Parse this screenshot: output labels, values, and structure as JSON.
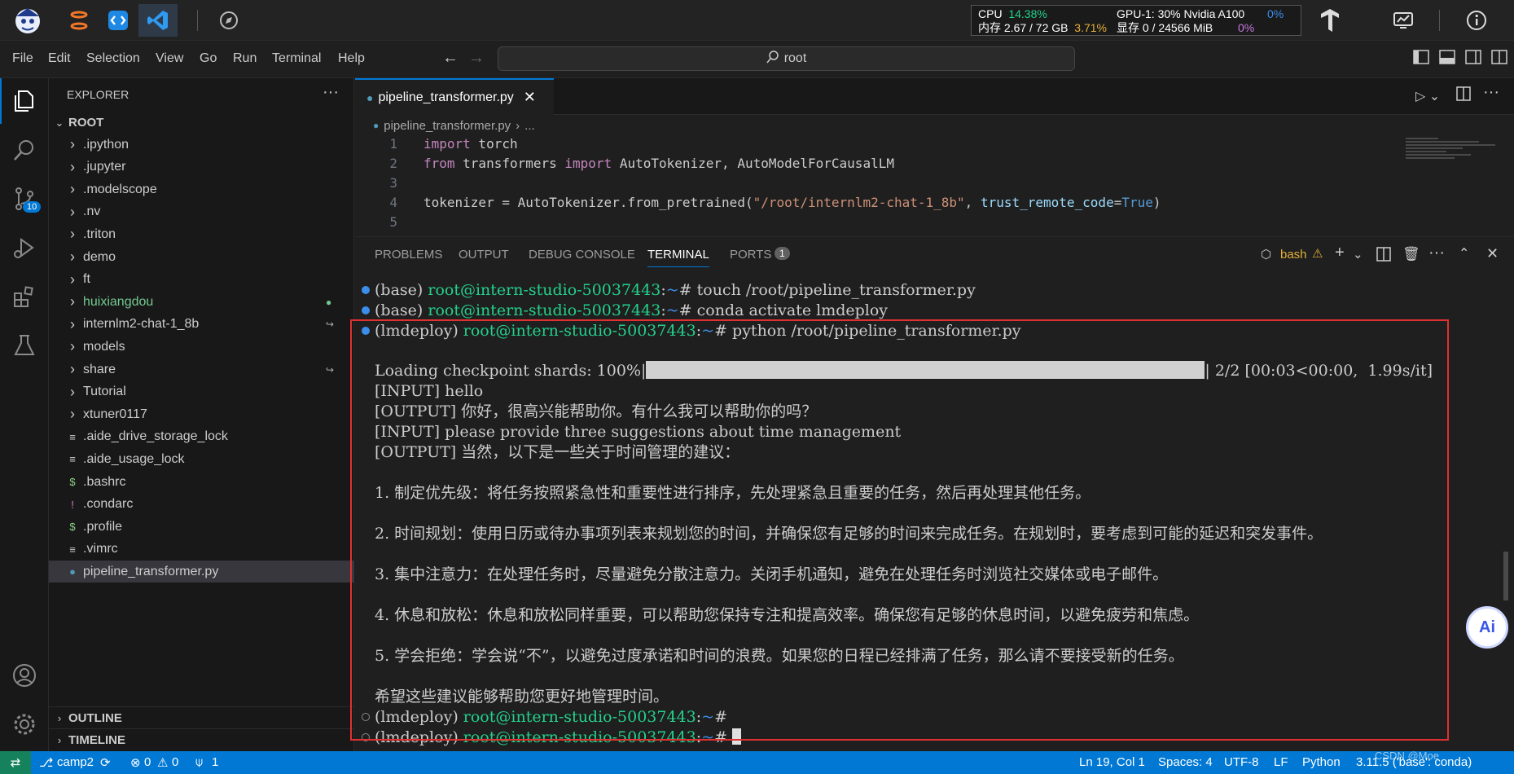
{
  "topbar": {
    "stats": {
      "cpu_label": "CPU",
      "cpu_value": "14.38%",
      "mem_label": "内存 2.67 / 72 GB",
      "mem_value": "3.71%",
      "gpu_label": "GPU-1: 30% Nvidia A100",
      "gpu_value": "0%",
      "vram_label": "显存 0 / 24566 MiB",
      "vram_value": "0%"
    }
  },
  "menu": [
    "File",
    "Edit",
    "Selection",
    "View",
    "Go",
    "Run",
    "Terminal",
    "Help"
  ],
  "command_center": {
    "text": "root"
  },
  "activity": {
    "badge": "10"
  },
  "explorer": {
    "title": "EXPLORER",
    "root": "ROOT",
    "items": [
      {
        "label": ".ipython",
        "type": "folder"
      },
      {
        "label": ".jupyter",
        "type": "folder"
      },
      {
        "label": ".modelscope",
        "type": "folder"
      },
      {
        "label": ".nv",
        "type": "folder"
      },
      {
        "label": ".triton",
        "type": "folder"
      },
      {
        "label": "demo",
        "type": "folder"
      },
      {
        "label": "ft",
        "type": "folder"
      },
      {
        "label": "huixiangdou",
        "type": "folder"
      },
      {
        "label": "internlm2-chat-1_8b",
        "type": "folder"
      },
      {
        "label": "models",
        "type": "folder"
      },
      {
        "label": "share",
        "type": "folder"
      },
      {
        "label": "Tutorial",
        "type": "folder"
      },
      {
        "label": "xtuner0117",
        "type": "folder"
      },
      {
        "label": ".aide_drive_storage_lock",
        "type": "file"
      },
      {
        "label": ".aide_usage_lock",
        "type": "file"
      },
      {
        "label": ".bashrc",
        "type": "file"
      },
      {
        "label": ".condarc",
        "type": "file"
      },
      {
        "label": ".profile",
        "type": "file"
      },
      {
        "label": ".vimrc",
        "type": "file"
      },
      {
        "label": "pipeline_transformer.py",
        "type": "file"
      }
    ],
    "outline": "OUTLINE",
    "timeline": "TIMELINE"
  },
  "editor": {
    "tab": "pipeline_transformer.py",
    "breadcrumb_file": "pipeline_transformer.py",
    "breadcrumb_more": "...",
    "line_numbers": [
      "1",
      "2",
      "3",
      "4",
      "5"
    ]
  },
  "panel": {
    "tabs": [
      "PROBLEMS",
      "OUTPUT",
      "DEBUG CONSOLE",
      "TERMINAL",
      "PORTS"
    ],
    "ports_badge": "1",
    "shell": "bash"
  },
  "terminal": {
    "prompt_user": "root@intern-studio-50037443",
    "prompt_path": "~",
    "lines": {
      "l1_env": "(base) ",
      "l1_cmd": "# touch /root/pipeline_transformer.py",
      "l2_env": "(base) ",
      "l2_cmd": "# conda activate lmdeploy",
      "l3_env": "(lmdeploy) ",
      "l3_cmd": "# python /root/pipeline_transformer.py",
      "loading": "Loading checkpoint shards: 100%|",
      "loading_tail": "| 2/2 [00:03<00:00,  1.99s/it]",
      "in1": "[INPUT] hello",
      "out1": "[OUTPUT] 你好，很高兴能帮助你。有什么我可以帮助你的吗？",
      "in2": "[INPUT] please provide three suggestions about time management",
      "out2": "[OUTPUT] 当然，以下是一些关于时间管理的建议：",
      "s1": "1. 制定优先级：将任务按照紧急性和重要性进行排序，先处理紧急且重要的任务，然后再处理其他任务。",
      "s2": "2. 时间规划：使用日历或待办事项列表来规划您的时间，并确保您有足够的时间来完成任务。在规划时，要考虑到可能的延迟和突发事件。",
      "s3": "3. 集中注意力：在处理任务时，尽量避免分散注意力。关闭手机通知，避免在处理任务时浏览社交媒体或电子邮件。",
      "s4": "4. 休息和放松：休息和放松同样重要，可以帮助您保持专注和提高效率。确保您有足够的休息时间，以避免疲劳和焦虑。",
      "s5": "5. 学会拒绝：学会说“不”，以避免过度承诺和时间的浪费。如果您的日程已经排满了任务，那么请不要接受新的任务。",
      "closing": "希望这些建议能够帮助您更好地管理时间。",
      "l4_env": "(lmdeploy) ",
      "l4_cmd": "#",
      "l5_env": "(lmdeploy) ",
      "l5_cmd": "# "
    },
    "progress": 1.0
  },
  "statusbar": {
    "branch": "camp2",
    "errors": "0",
    "warnings": "0",
    "ports": "1",
    "position": "Ln 19, Col 1",
    "spaces": "Spaces: 4",
    "encoding": "UTF-8",
    "eol": "LF",
    "language": "Python",
    "interpreter": "3.11.5 ('base': conda)",
    "watermark": "CSDN @Moe"
  },
  "ai_button": "Ai",
  "colors": {
    "accent": "#0078d4",
    "prompt_green": "#23d18b",
    "prompt_blue": "#3b8eea",
    "highlight_box": "#e03131"
  }
}
